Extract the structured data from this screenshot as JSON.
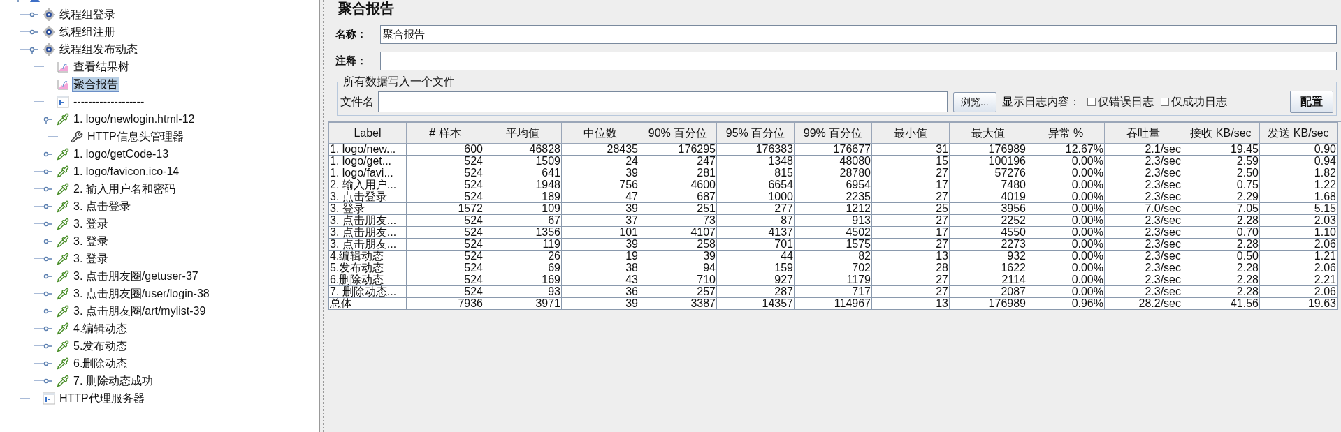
{
  "tree": {
    "kind": "plan",
    "expanded": true,
    "children": [
      {
        "label": "线程组登录",
        "kind": "thread_group",
        "expanded": false,
        "selected": false
      },
      {
        "label": "线程组注册",
        "kind": "thread_group",
        "expanded": false,
        "selected": false
      },
      {
        "label": "线程组发布动态",
        "kind": "thread_group",
        "expanded": true,
        "selected": false,
        "children": [
          {
            "label": "查看结果树",
            "kind": "listener",
            "selected": false
          },
          {
            "label": "聚合报告",
            "kind": "listener",
            "selected": true
          },
          {
            "label": "-------------------",
            "kind": "controller",
            "selected": false
          },
          {
            "label": "1. logo/newlogin.html-12",
            "kind": "sampler",
            "expanded": true,
            "selected": false,
            "children": [
              {
                "label": "HTTP信息头管理器",
                "kind": "config",
                "selected": false
              }
            ]
          },
          {
            "label": "1. logo/getCode-13",
            "kind": "sampler",
            "expanded": false,
            "selected": false
          },
          {
            "label": "1. logo/favicon.ico-14",
            "kind": "sampler",
            "expanded": false,
            "selected": false
          },
          {
            "label": "2. 输入用户名和密码",
            "kind": "sampler",
            "expanded": false,
            "selected": false
          },
          {
            "label": "3. 点击登录",
            "kind": "sampler",
            "expanded": false,
            "selected": false
          },
          {
            "label": "3. 登录",
            "kind": "sampler",
            "expanded": false,
            "selected": false
          },
          {
            "label": "3. 登录",
            "kind": "sampler",
            "expanded": false,
            "selected": false
          },
          {
            "label": "3. 登录",
            "kind": "sampler",
            "expanded": false,
            "selected": false
          },
          {
            "label": "3. 点击朋友圈/getuser-37",
            "kind": "sampler",
            "expanded": false,
            "selected": false
          },
          {
            "label": "3. 点击朋友圈/user/login-38",
            "kind": "sampler",
            "expanded": false,
            "selected": false
          },
          {
            "label": "3. 点击朋友圈/art/mylist-39",
            "kind": "sampler",
            "expanded": false,
            "selected": false
          },
          {
            "label": "4.编辑动态",
            "kind": "sampler",
            "expanded": false,
            "selected": false
          },
          {
            "label": "5.发布动态",
            "kind": "sampler",
            "expanded": false,
            "selected": false
          },
          {
            "label": "6.删除动态",
            "kind": "sampler",
            "expanded": false,
            "selected": false
          },
          {
            "label": "7. 删除动态成功",
            "kind": "sampler",
            "expanded": false,
            "selected": false
          }
        ]
      },
      {
        "label": "HTTP代理服务器",
        "kind": "controller",
        "selected": false
      }
    ]
  },
  "panel": {
    "title": "聚合报告",
    "name": {
      "label": "名称：",
      "value": "聚合报告"
    },
    "comment": {
      "label": "注释："
    },
    "file_group": {
      "legend": "所有数据写入一个文件",
      "file_label": "文件名",
      "browse_button": "浏览...",
      "log_label": "显示日志内容：",
      "checkboxes": [
        {
          "label": "仅错误日志",
          "checked": false
        },
        {
          "label": "仅成功日志",
          "checked": false
        }
      ],
      "config_button": "配置"
    }
  },
  "table": {
    "columns": [
      "Label",
      "# 样本",
      "平均值",
      "中位数",
      "90% 百分位",
      "95% 百分位",
      "99% 百分位",
      "最小值",
      "最大值",
      "异常 %",
      "吞吐量",
      "接收 KB/sec",
      "发送 KB/sec"
    ],
    "rows": [
      [
        "1. logo/new...",
        "600",
        "46828",
        "28435",
        "176295",
        "176383",
        "176677",
        "31",
        "176989",
        "12.67%",
        "2.1/sec",
        "19.45",
        "0.90"
      ],
      [
        "1. logo/get...",
        "524",
        "1509",
        "24",
        "247",
        "1348",
        "48080",
        "15",
        "100196",
        "0.00%",
        "2.3/sec",
        "2.59",
        "0.94"
      ],
      [
        "1. logo/favi...",
        "524",
        "641",
        "39",
        "281",
        "815",
        "28780",
        "27",
        "57276",
        "0.00%",
        "2.3/sec",
        "2.50",
        "1.82"
      ],
      [
        "2. 输入用户...",
        "524",
        "1948",
        "756",
        "4600",
        "6654",
        "6954",
        "17",
        "7480",
        "0.00%",
        "2.3/sec",
        "0.75",
        "1.22"
      ],
      [
        "3. 点击登录",
        "524",
        "189",
        "47",
        "687",
        "1000",
        "2235",
        "27",
        "4019",
        "0.00%",
        "2.3/sec",
        "2.29",
        "1.68"
      ],
      [
        "3. 登录",
        "1572",
        "109",
        "39",
        "251",
        "277",
        "1212",
        "25",
        "3956",
        "0.00%",
        "7.0/sec",
        "7.05",
        "5.15"
      ],
      [
        "3. 点击朋友...",
        "524",
        "67",
        "37",
        "73",
        "87",
        "913",
        "27",
        "2252",
        "0.00%",
        "2.3/sec",
        "2.28",
        "2.03"
      ],
      [
        "3. 点击朋友...",
        "524",
        "1356",
        "101",
        "4107",
        "4137",
        "4502",
        "17",
        "4550",
        "0.00%",
        "2.3/sec",
        "0.70",
        "1.10"
      ],
      [
        "3. 点击朋友...",
        "524",
        "119",
        "39",
        "258",
        "701",
        "1575",
        "27",
        "2273",
        "0.00%",
        "2.3/sec",
        "2.28",
        "2.06"
      ],
      [
        "4.编辑动态",
        "524",
        "26",
        "19",
        "39",
        "44",
        "82",
        "13",
        "932",
        "0.00%",
        "2.3/sec",
        "0.50",
        "1.21"
      ],
      [
        "5.发布动态",
        "524",
        "69",
        "38",
        "94",
        "159",
        "702",
        "28",
        "1622",
        "0.00%",
        "2.3/sec",
        "2.28",
        "2.06"
      ],
      [
        "6.删除动态",
        "524",
        "169",
        "43",
        "710",
        "927",
        "1179",
        "27",
        "2114",
        "0.00%",
        "2.3/sec",
        "2.28",
        "2.21"
      ],
      [
        "7. 删除动态...",
        "524",
        "93",
        "36",
        "257",
        "287",
        "717",
        "27",
        "2087",
        "0.00%",
        "2.3/sec",
        "2.28",
        "2.06"
      ],
      [
        "总体",
        "7936",
        "3971",
        "39",
        "3387",
        "14357",
        "114967",
        "13",
        "176989",
        "0.96%",
        "28.2/sec",
        "41.56",
        "19.63"
      ]
    ]
  }
}
